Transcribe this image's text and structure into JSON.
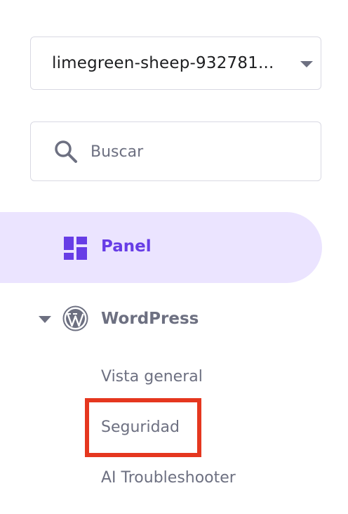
{
  "site_select": {
    "value": "limegreen-sheep-932781...",
    "chevron_icon": "chevron-down-icon"
  },
  "search": {
    "placeholder": "Buscar",
    "value": "",
    "icon": "search-icon"
  },
  "nav": {
    "panel": {
      "label": "Panel",
      "icon": "dashboard-icon",
      "active": true
    },
    "wordpress": {
      "label": "WordPress",
      "icon": "wordpress-icon",
      "expanded": true,
      "items": [
        {
          "label": "Vista general"
        },
        {
          "label": "Seguridad",
          "highlighted": true
        },
        {
          "label": "AI Troubleshooter"
        }
      ]
    }
  },
  "colors": {
    "accent": "#673de6",
    "active_bg": "#ebe4ff",
    "muted_text": "#6d7081",
    "highlight": "#e5371f",
    "border": "#d9d9e3"
  }
}
